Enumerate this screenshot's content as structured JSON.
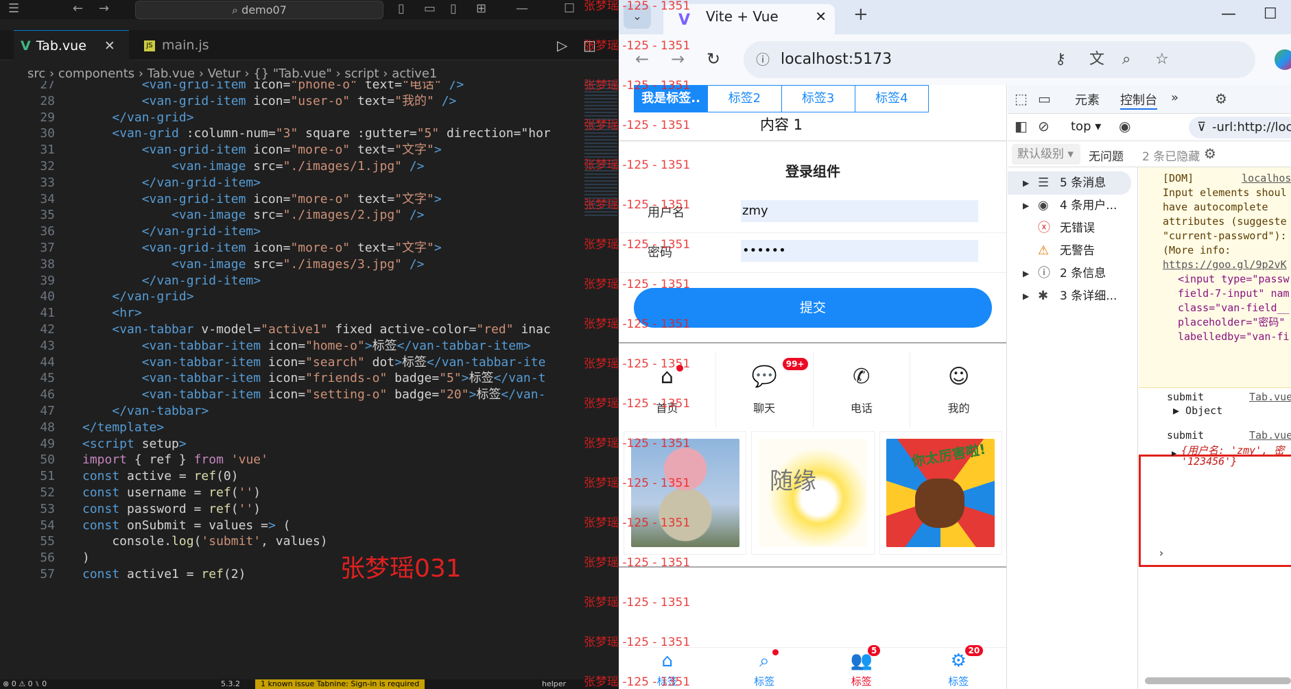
{
  "vscode": {
    "search": "demo07",
    "tabs": [
      {
        "label": "Tab.vue",
        "close": "✕"
      },
      {
        "label": "main.js"
      }
    ],
    "breadcrumb": "src › components › Tab.vue › Vetur › {} \"Tab.vue\" › script › active1",
    "watermark": "张梦瑶031",
    "status": {
      "left": "⊗ 0 ⚠ 0   ⑊ 0",
      "version": "5.3.2",
      "issue": "1 known issue",
      "tabnine": "Tabnine: Sign-in is required",
      "helper": "helper"
    },
    "lines": [
      {
        "n": "27",
        "code": "        <van-grid-item icon=\"phone-o\" text=\"电话\" />"
      },
      {
        "n": "28",
        "code": "        <van-grid-item icon=\"user-o\" text=\"我的\" />"
      },
      {
        "n": "29",
        "code": "    </van-grid>"
      },
      {
        "n": "30",
        "code": "    <van-grid :column-num=\"3\" square :gutter=\"5\" direction=\"hor"
      },
      {
        "n": "31",
        "code": "        <van-grid-item icon=\"more-o\" text=\"文字\">"
      },
      {
        "n": "32",
        "code": "            <van-image src=\"./images/1.jpg\" />"
      },
      {
        "n": "33",
        "code": "        </van-grid-item>"
      },
      {
        "n": "34",
        "code": "        <van-grid-item icon=\"more-o\" text=\"文字\">"
      },
      {
        "n": "35",
        "code": "            <van-image src=\"./images/2.jpg\" />"
      },
      {
        "n": "36",
        "code": "        </van-grid-item>"
      },
      {
        "n": "37",
        "code": "        <van-grid-item icon=\"more-o\" text=\"文字\">"
      },
      {
        "n": "38",
        "code": "            <van-image src=\"./images/3.jpg\" />"
      },
      {
        "n": "39",
        "code": "        </van-grid-item>"
      },
      {
        "n": "40",
        "code": "    </van-grid>"
      },
      {
        "n": "41",
        "code": "    <hr>"
      },
      {
        "n": "42",
        "code": "    <van-tabbar v-model=\"active1\" fixed active-color=\"red\" inac"
      },
      {
        "n": "43",
        "code": "        <van-tabbar-item icon=\"home-o\">标签</van-tabbar-item>"
      },
      {
        "n": "44",
        "code": "        <van-tabbar-item icon=\"search\" dot>标签</van-tabbar-ite"
      },
      {
        "n": "45",
        "code": "        <van-tabbar-item icon=\"friends-o\" badge=\"5\">标签</van-t"
      },
      {
        "n": "46",
        "code": "        <van-tabbar-item icon=\"setting-o\" badge=\"20\">标签</van-"
      },
      {
        "n": "47",
        "code": "    </van-tabbar>"
      },
      {
        "n": "48",
        "code": "</template>"
      },
      {
        "n": "49",
        "code": "<script setup>"
      },
      {
        "n": "50",
        "code": "import { ref } from 'vue'"
      },
      {
        "n": "51",
        "code": "const active = ref(0)"
      },
      {
        "n": "52",
        "code": "const username = ref('')"
      },
      {
        "n": "53",
        "code": "const password = ref('')"
      },
      {
        "n": "54",
        "code": "const onSubmit = values => ("
      },
      {
        "n": "55",
        "code": "    console.log('submit', values)"
      },
      {
        "n": "56",
        "code": ")"
      },
      {
        "n": "57",
        "code": "const active1 = ref(2)"
      }
    ]
  },
  "watermark_text": "张梦瑶 -125 - 1351",
  "browser": {
    "tab_title": "Vite + Vue",
    "tab_close": "✕",
    "new_tab": "+",
    "url": "localhost:5173",
    "page": {
      "tabs": [
        "我是标签..",
        "标签2",
        "标签3",
        "标签4"
      ],
      "content": "内容 1",
      "login_title": "登录组件",
      "username_label": "用户名",
      "username_value": "zmy",
      "password_label": "密码",
      "password_value": "••••••",
      "submit": "提交",
      "grid": [
        {
          "icon": "home-icon",
          "label": "首页",
          "dot": true
        },
        {
          "icon": "chat-icon",
          "label": "聊天",
          "badge": "99+"
        },
        {
          "icon": "phone-icon",
          "label": "电话"
        },
        {
          "icon": "user-icon",
          "label": "我的"
        }
      ],
      "images": [
        "./images/1.jpg",
        "./images/2.jpg",
        "./images/3.jpg"
      ],
      "image3_text": "你太厉害啦!",
      "image2_text": "随缘",
      "tabbar": [
        {
          "label": "标签",
          "icon": "home-icon",
          "color": "#1989fa"
        },
        {
          "label": "标签",
          "icon": "search-icon",
          "color": "#1989fa",
          "dot": true
        },
        {
          "label": "标签",
          "icon": "friends-icon",
          "color": "#ee0a24",
          "badge": "5"
        },
        {
          "label": "标签",
          "icon": "setting-icon",
          "color": "#1989fa",
          "badge": "20"
        }
      ]
    },
    "devtools": {
      "tabs": [
        "元素",
        "控制台",
        "»"
      ],
      "context": "top ▾",
      "filter": "-url:http://loca",
      "level": "默认级别 ▾",
      "no_issues": "无问题",
      "hidden": "2 条已隐藏",
      "sidebar": [
        {
          "label": "5 条消息",
          "arrow": "▶",
          "icon": "☰"
        },
        {
          "label": "4 条用户...",
          "arrow": "▶",
          "icon": "◉"
        },
        {
          "label": "无错误",
          "icon": "ⓧ"
        },
        {
          "label": "无警告",
          "icon": "⚠"
        },
        {
          "label": "2 条信息",
          "arrow": "▶",
          "icon": "ⓘ"
        },
        {
          "label": "3 条详细...",
          "arrow": "▶",
          "icon": "✱"
        }
      ],
      "warning": {
        "tag": "[DOM]",
        "source": "localhost",
        "lines": [
          "Input elements shoul",
          "have autocomplete",
          "attributes (suggeste",
          "\"current-password\"):",
          "(More info:"
        ],
        "link": "https://goo.gl/9p2vK",
        "node_lines": [
          "<input type=\"passw",
          "field-7-input\" nam",
          "class=\"van-field__",
          "placeholder=\"密码\"",
          "labelledby=\"van-fi"
        ]
      },
      "logs": [
        {
          "text": "submit",
          "source": "Tab.vue",
          "detail": "▶ Object"
        },
        {
          "text": "submit",
          "source": "Tab.vue",
          "detail": "{用户名: 'zmy', 密",
          "detail2": "'123456'}"
        }
      ],
      "prompt": "›"
    }
  }
}
